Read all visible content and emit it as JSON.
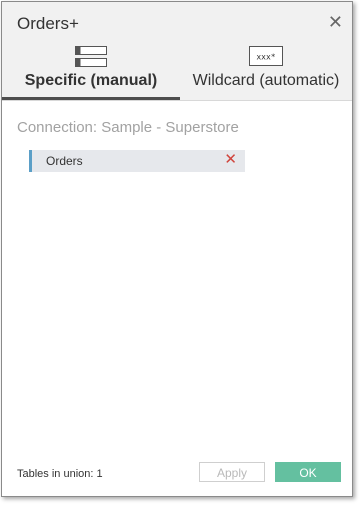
{
  "dialog": {
    "title": "Orders+",
    "close_icon": "close-icon"
  },
  "tabs": [
    {
      "label": "Specific (manual)",
      "icon": "stacked-tables-icon",
      "active": true
    },
    {
      "label": "Wildcard (automatic)",
      "icon": "wildcard-box-icon",
      "icon_text": "xxx*",
      "active": false
    }
  ],
  "connection_text": "Connection: Sample - Superstore",
  "tables": [
    {
      "label": "Orders",
      "remove_icon": "remove-x-icon"
    }
  ],
  "footer": {
    "count_text": "Tables in union: 1",
    "apply_label": "Apply",
    "ok_label": "OK"
  },
  "colors": {
    "accent_blue": "#5b9fc7",
    "ok_green": "#64c0a0",
    "remove_red": "#d0443c"
  }
}
